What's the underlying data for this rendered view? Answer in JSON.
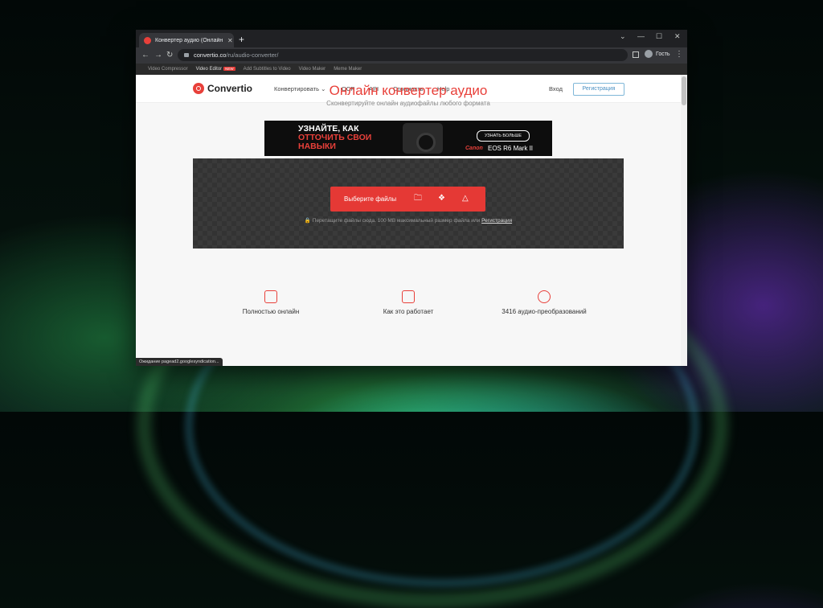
{
  "browser": {
    "tab_title": "Конвертер аудио (Онлайн и бе",
    "new_tab": "+",
    "url_host": "convertio.co",
    "url_path": "/ru/audio-converter/",
    "profile_label": "Гость",
    "status_text": "Ожидание pagead2.googlesyndication..."
  },
  "top_strip": {
    "links": [
      "Video Compressor",
      "Video Editor",
      "Add Subtitles to Video",
      "Video Maker",
      "Meme Maker"
    ],
    "new_badge": "NEW"
  },
  "header": {
    "logo": "Convertio",
    "nav": {
      "convert": "Конвертировать",
      "ocr": "OCR",
      "api": "API",
      "pricing": "Стоимость",
      "help": "Help"
    },
    "login": "Вход",
    "signup": "Регистрация"
  },
  "hero": {
    "title": "Онлайн конвертер аудио",
    "subtitle": "Сконвертируйте онлайн аудиофайлы любого формата"
  },
  "ad": {
    "line1": "УЗНАЙТЕ, КАК",
    "line2": "ОТТОЧИТЬ СВОИ",
    "line3": "НАВЫКИ",
    "cta": "УЗНАТЬ БОЛЬШЕ",
    "brand": "Canon",
    "model": "EOS R6 Mark II"
  },
  "upload": {
    "choose_files": "Выберите файлы",
    "hint": "Перетащите файлы сюда. 100 MB максимальный размер файла или",
    "hint_link": "Регистрация"
  },
  "features": [
    {
      "label": "Полностью онлайн",
      "icon": "cursor-window-icon"
    },
    {
      "label": "Как это работает",
      "icon": "clipboard-check-icon"
    },
    {
      "label": "3416 аудио-преобразований",
      "icon": "refresh-icon"
    }
  ],
  "colors": {
    "brand": "#e8403a",
    "button": "#e53935",
    "signup_border": "#7fb7d8"
  }
}
